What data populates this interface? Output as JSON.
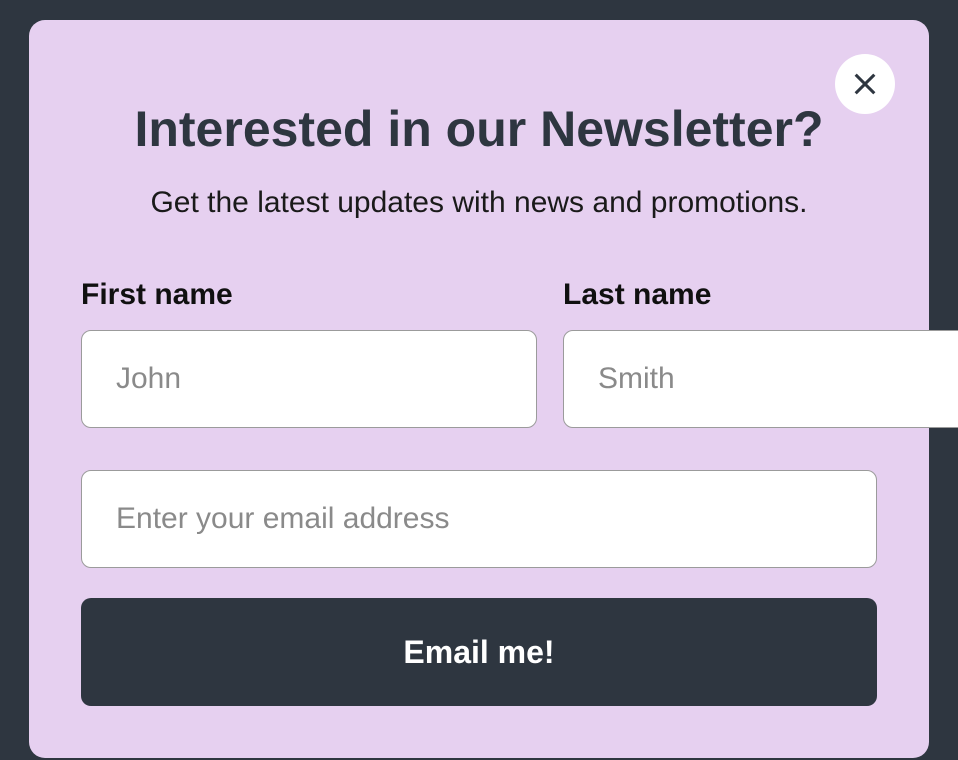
{
  "modal": {
    "title": "Interested in our Newsletter?",
    "subtitle": "Get the latest updates with news and promotions.",
    "firstName": {
      "label": "First name",
      "placeholder": "John"
    },
    "lastName": {
      "label": "Last name",
      "placeholder": "Smith"
    },
    "email": {
      "placeholder": "Enter your email address"
    },
    "submitLabel": "Email me!"
  }
}
